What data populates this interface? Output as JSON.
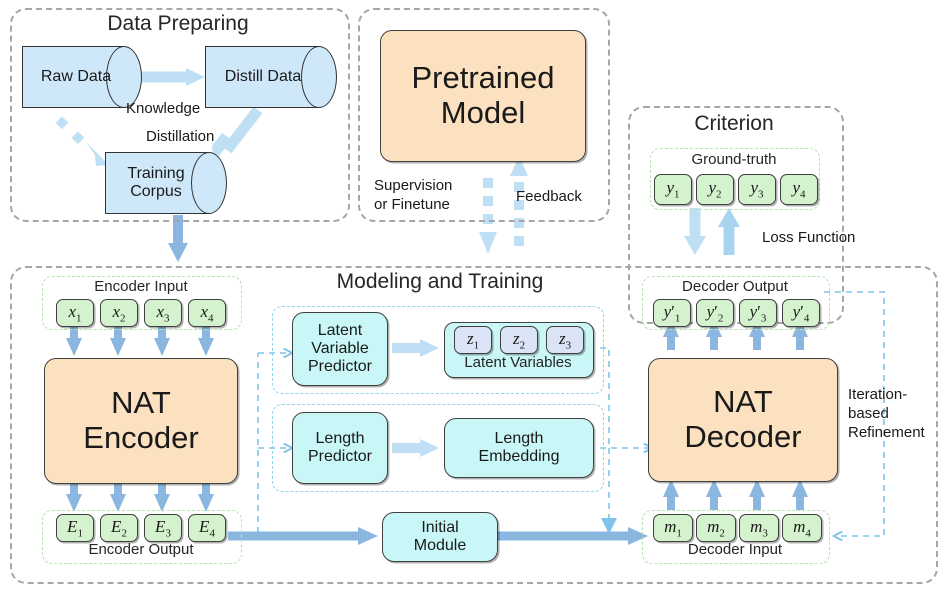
{
  "groups": {
    "data_preparing": {
      "title": "Data Preparing"
    },
    "pretrained": {
      "title": ""
    },
    "criterion": {
      "title": "Criterion"
    },
    "modeling": {
      "title": "Modeling and Training"
    }
  },
  "data_preparing": {
    "raw_data": "Raw Data",
    "distill_data": "Distill Data",
    "training_corpus_line1": "Training",
    "training_corpus_line2": "Corpus",
    "knowledge": "Knowledge",
    "distillation": "Distillation"
  },
  "pretrained": {
    "line1": "Pretrained",
    "line2": "Model",
    "supervision_line1": "Supervision",
    "supervision_line2": "or Finetune",
    "feedback": "Feedback"
  },
  "criterion": {
    "ground_truth_label": "Ground-truth",
    "ground_truth_tokens": [
      "y",
      "y",
      "y",
      "y"
    ],
    "ground_truth_subs": [
      "1",
      "2",
      "3",
      "4"
    ],
    "loss_function": "Loss Function"
  },
  "modeling": {
    "encoder_input_label": "Encoder Input",
    "encoder_input_tokens": [
      "x",
      "x",
      "x",
      "x"
    ],
    "encoder_input_subs": [
      "1",
      "2",
      "3",
      "4"
    ],
    "nat_encoder_line1": "NAT",
    "nat_encoder_line2": "Encoder",
    "encoder_output_label": "Encoder Output",
    "encoder_output_tokens": [
      "E",
      "E",
      "E",
      "E"
    ],
    "encoder_output_subs": [
      "1",
      "2",
      "3",
      "4"
    ],
    "latent_predictor_line1": "Latent",
    "latent_predictor_line2": "Variable",
    "latent_predictor_line3": "Predictor",
    "latent_variables_label": "Latent Variables",
    "latent_tokens": [
      "z",
      "z",
      "z"
    ],
    "latent_subs": [
      "1",
      "2",
      "3"
    ],
    "length_predictor_line1": "Length",
    "length_predictor_line2": "Predictor",
    "length_embedding_line1": "Length",
    "length_embedding_line2": "Embedding",
    "initial_module_line1": "Initial",
    "initial_module_line2": "Module",
    "nat_decoder_line1": "NAT",
    "nat_decoder_line2": "Decoder",
    "decoder_output_label": "Decoder Output",
    "decoder_output_tokens": [
      "y",
      "y",
      "y",
      "y"
    ],
    "decoder_output_subs": [
      "1",
      "2",
      "3",
      "4"
    ],
    "decoder_input_label": "Decoder Input",
    "decoder_input_tokens": [
      "m",
      "m",
      "m",
      "m"
    ],
    "decoder_input_subs": [
      "1",
      "2",
      "3",
      "4"
    ],
    "refinement_line1": "Iteration-",
    "refinement_line2": "based",
    "refinement_line3": "Refinement"
  },
  "colors": {
    "orange": "#fce1c0",
    "cyan": "#c9f6f7",
    "green": "#d5f2cf",
    "cylinder_blue": "#cfe8f9",
    "arrow_blue": "#8ab6e0",
    "arrow_light_blue": "#bfe0f4",
    "group_border": "#a6a6a6",
    "dashed_blue": "#7fc4e8"
  }
}
